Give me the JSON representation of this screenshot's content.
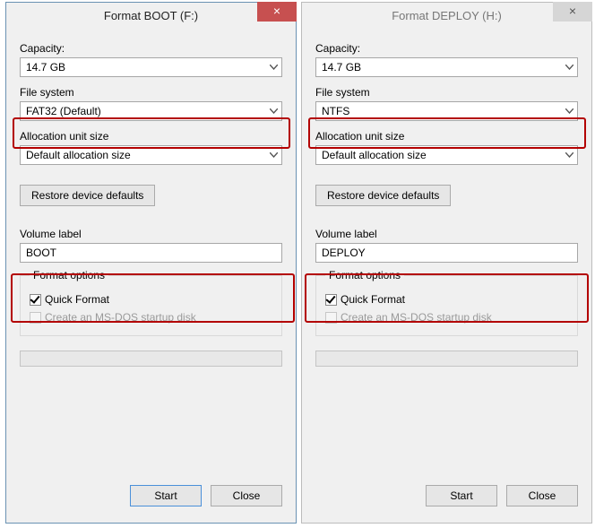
{
  "dialogs": [
    {
      "id": "boot",
      "title": "Format BOOT (F:)",
      "active": true,
      "capacity": {
        "label": "Capacity:",
        "value": "14.7 GB"
      },
      "filesystem": {
        "label": "File system",
        "value": "FAT32 (Default)"
      },
      "alloc": {
        "label": "Allocation unit size",
        "value": "Default allocation size"
      },
      "restore_label": "Restore device defaults",
      "volume": {
        "label": "Volume label",
        "value": "BOOT"
      },
      "options": {
        "group": "Format options",
        "quick": {
          "label": "Quick Format",
          "checked": true
        },
        "msdos": {
          "label": "Create an MS-DOS startup disk",
          "enabled": false
        }
      },
      "buttons": {
        "start": "Start",
        "close": "Close"
      }
    },
    {
      "id": "deploy",
      "title": "Format DEPLOY (H:)",
      "active": false,
      "capacity": {
        "label": "Capacity:",
        "value": "14.7 GB"
      },
      "filesystem": {
        "label": "File system",
        "value": "NTFS"
      },
      "alloc": {
        "label": "Allocation unit size",
        "value": "Default allocation size"
      },
      "restore_label": "Restore device defaults",
      "volume": {
        "label": "Volume label",
        "value": "DEPLOY"
      },
      "options": {
        "group": "Format options",
        "quick": {
          "label": "Quick Format",
          "checked": true
        },
        "msdos": {
          "label": "Create an MS-DOS startup disk",
          "enabled": false
        }
      },
      "buttons": {
        "start": "Start",
        "close": "Close"
      }
    }
  ],
  "highlight_color": "#b30000"
}
